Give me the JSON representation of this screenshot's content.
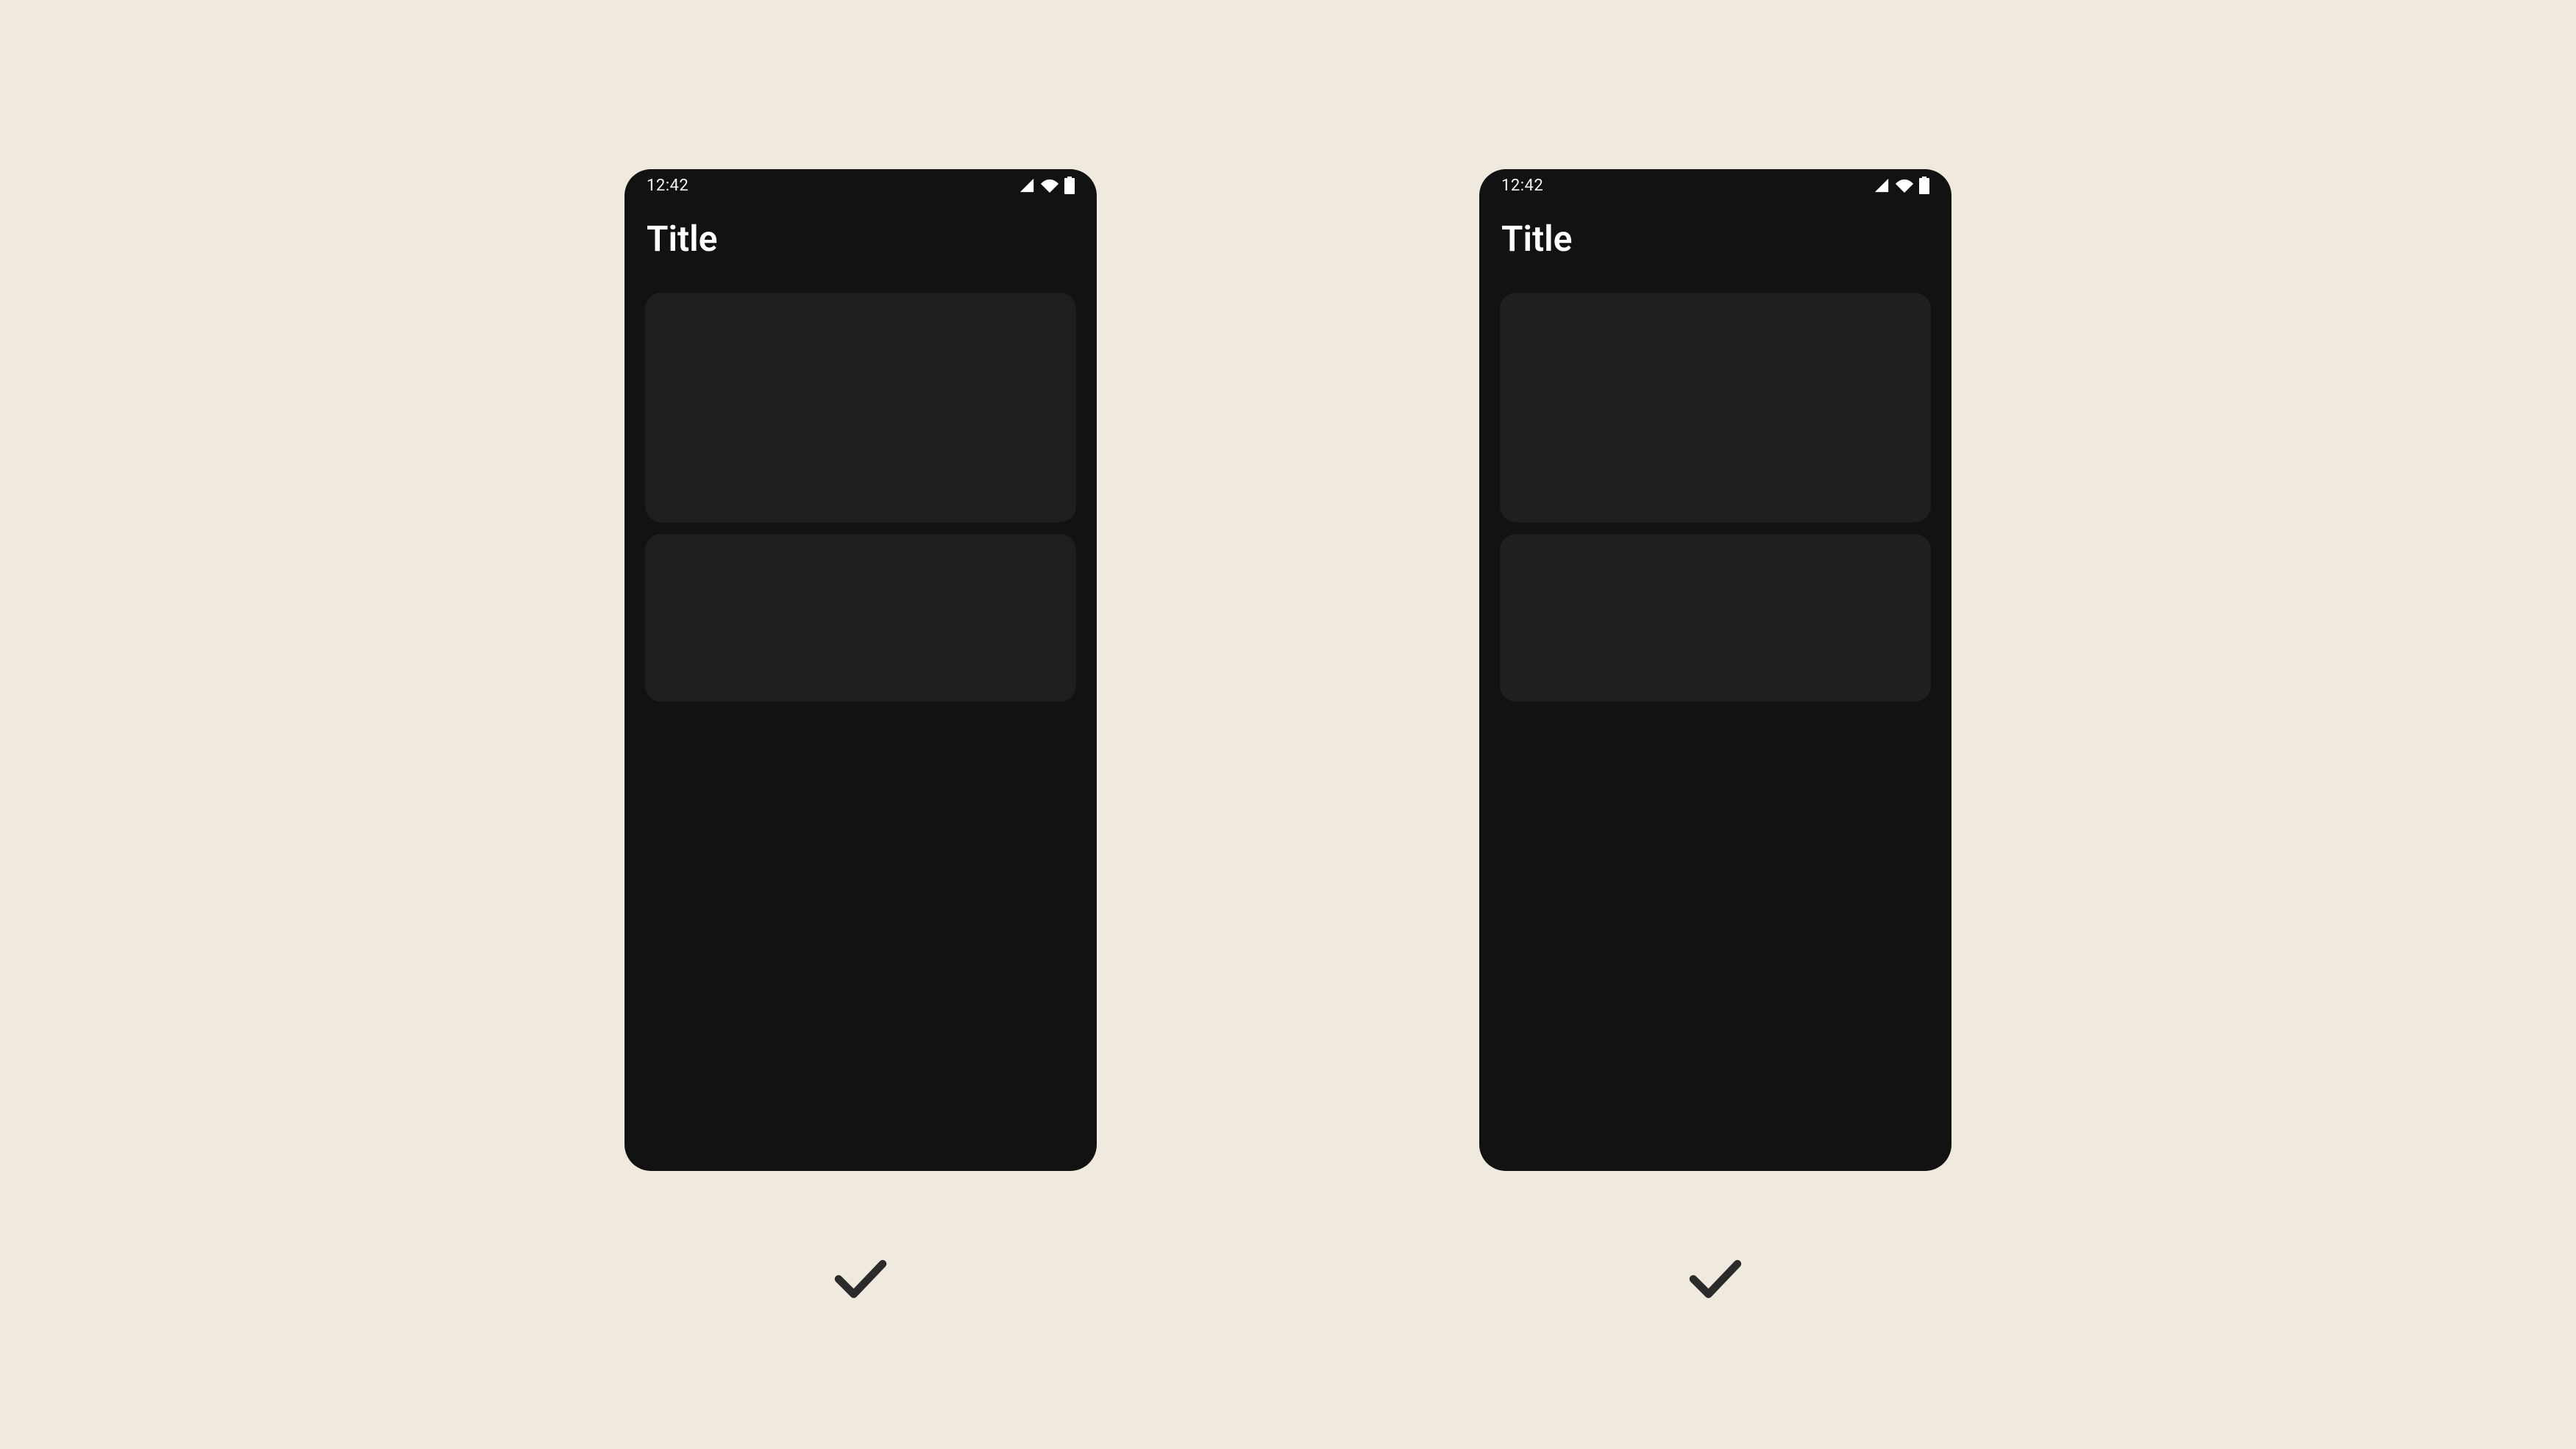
{
  "examples": [
    {
      "statusbar": {
        "time": "12:42"
      },
      "appbar": {
        "title": "Title"
      },
      "status": "do"
    },
    {
      "statusbar": {
        "time": "12:42"
      },
      "appbar": {
        "title": "Title"
      },
      "status": "do"
    }
  ]
}
